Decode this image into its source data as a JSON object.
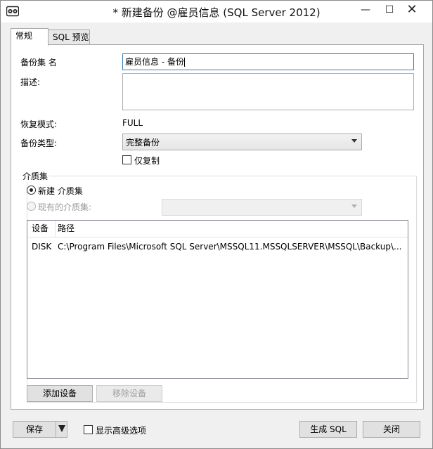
{
  "window": {
    "title": "* 新建备份 @雇员信息 (SQL Server 2012)",
    "minimize_glyph": "—",
    "maximize_glyph": "☐",
    "close_glyph": "✕",
    "icon": "sql-app-icon"
  },
  "tabs": [
    {
      "label": "常规",
      "active": true
    },
    {
      "label": "SQL 预览",
      "active": false
    }
  ],
  "form": {
    "backup_set_name_label": "备份集 名",
    "backup_set_name_value": "雇员信息 - 备份",
    "description_label": "描述:",
    "description_value": "",
    "recovery_model_label": "恢复模式:",
    "recovery_model_value": "FULL",
    "backup_type_label": "备份类型:",
    "backup_type_value": "完整备份",
    "copy_only_label": "仅复制",
    "copy_only_checked": false
  },
  "media_set": {
    "title": "介质集",
    "new_media_label": "新建 介质集",
    "existing_media_label": "现有的介质集:",
    "existing_media_value": "",
    "columns": [
      "设备",
      "路径"
    ],
    "rows": [
      {
        "device": "DISK",
        "path": "C:\\Program Files\\Microsoft SQL Server\\MSSQL11.MSSQLSERVER\\MSSQL\\Backup\\..."
      }
    ],
    "add_device_label": "添加设备",
    "remove_device_label": "移除设备"
  },
  "footer": {
    "save_label": "保存",
    "show_advanced_label": "显示高级选项",
    "generate_sql_label": "生成 SQL",
    "close_label": "关闭"
  }
}
